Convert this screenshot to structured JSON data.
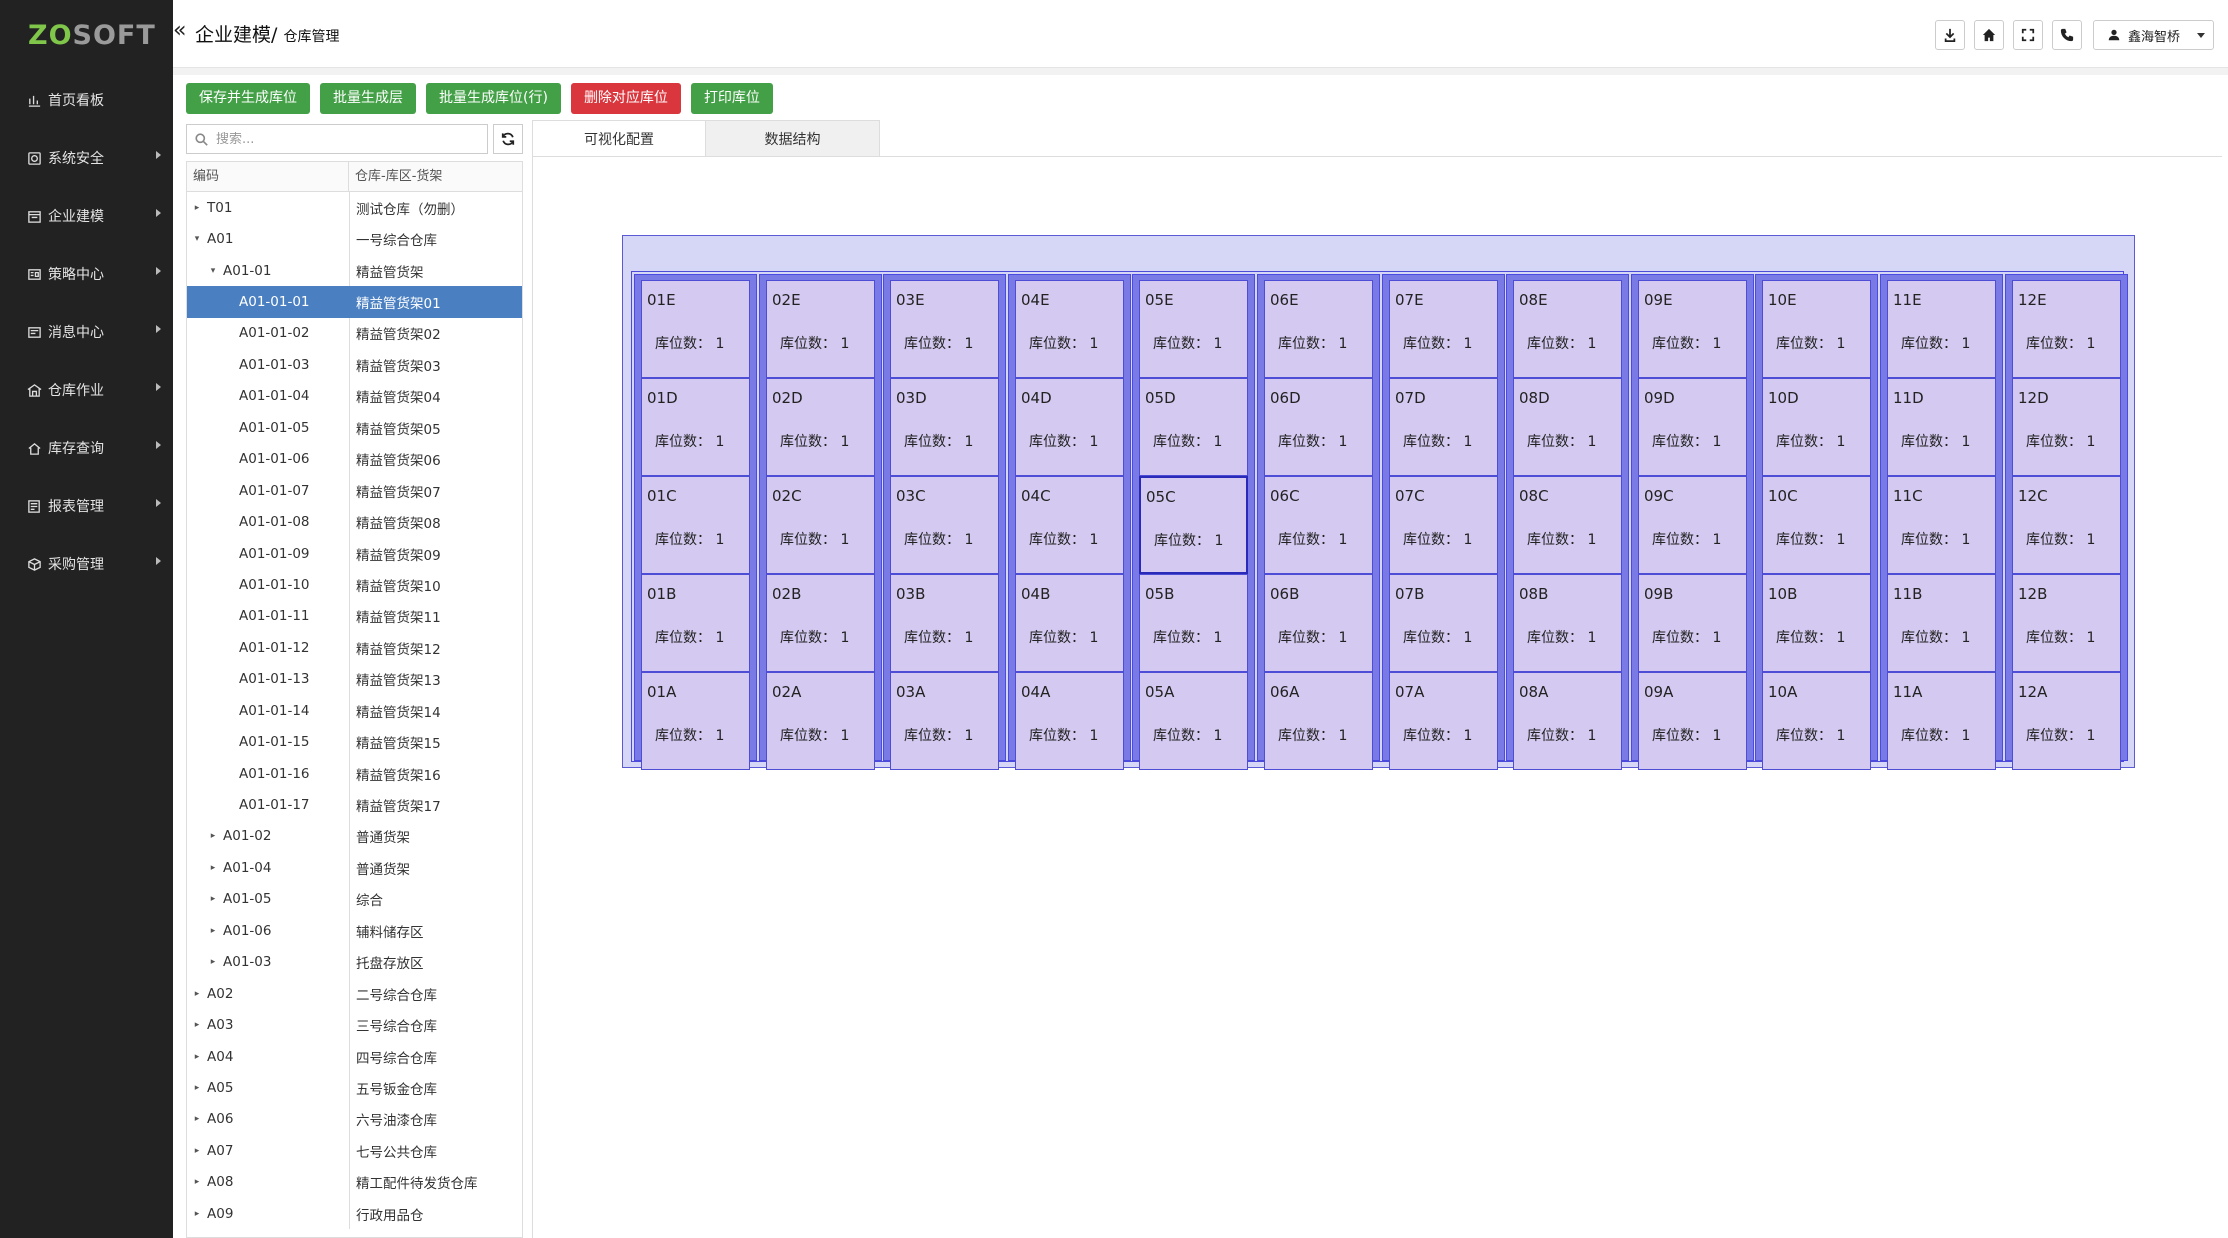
{
  "brand": {
    "logo_part1": "ZO",
    "logo_part2": "SOFT",
    "logo_color": "#7fc64a"
  },
  "sidebar": {
    "items": [
      {
        "label": "首页看板",
        "icon": "chart-icon",
        "has_children": false
      },
      {
        "label": "系统安全",
        "icon": "shield-icon",
        "has_children": true
      },
      {
        "label": "企业建模",
        "icon": "building-icon",
        "has_children": true
      },
      {
        "label": "策略中心",
        "icon": "strategy-icon",
        "has_children": true
      },
      {
        "label": "消息中心",
        "icon": "message-icon",
        "has_children": true
      },
      {
        "label": "仓库作业",
        "icon": "warehouse-icon",
        "has_children": true
      },
      {
        "label": "库存查询",
        "icon": "inventory-icon",
        "has_children": true
      },
      {
        "label": "报表管理",
        "icon": "report-icon",
        "has_children": true
      },
      {
        "label": "采购管理",
        "icon": "purchase-icon",
        "has_children": true
      }
    ]
  },
  "header": {
    "breadcrumb_main": "企业建模/",
    "breadcrumb_sub": "仓库管理",
    "tools": [
      "download-icon",
      "home-icon",
      "fullscreen-icon",
      "phone-icon"
    ],
    "user_name": "鑫海智桥"
  },
  "toolbar": {
    "buttons": [
      {
        "label": "保存并生成库位",
        "color": "#43a047"
      },
      {
        "label": "批量生成层",
        "color": "#43a047"
      },
      {
        "label": "批量生成库位(行)",
        "color": "#43a047"
      },
      {
        "label": "删除对应库位",
        "color": "#d9363e"
      },
      {
        "label": "打印库位",
        "color": "#43a047"
      }
    ]
  },
  "search": {
    "placeholder": "搜索...",
    "value": ""
  },
  "tree": {
    "columns": [
      "编码",
      "仓库-库区-货架"
    ],
    "rows": [
      {
        "code": "T01",
        "name": "测试仓库（勿删）",
        "level": 0,
        "toggle": "collapsed",
        "selected": false
      },
      {
        "code": "A01",
        "name": "一号综合仓库",
        "level": 0,
        "toggle": "expanded",
        "selected": false
      },
      {
        "code": "A01-01",
        "name": "精益管货架",
        "level": 1,
        "toggle": "expanded",
        "selected": false
      },
      {
        "code": "A01-01-01",
        "name": "精益管货架01",
        "level": 2,
        "toggle": "none",
        "selected": true
      },
      {
        "code": "A01-01-02",
        "name": "精益管货架02",
        "level": 2,
        "toggle": "none",
        "selected": false
      },
      {
        "code": "A01-01-03",
        "name": "精益管货架03",
        "level": 2,
        "toggle": "none",
        "selected": false
      },
      {
        "code": "A01-01-04",
        "name": "精益管货架04",
        "level": 2,
        "toggle": "none",
        "selected": false
      },
      {
        "code": "A01-01-05",
        "name": "精益管货架05",
        "level": 2,
        "toggle": "none",
        "selected": false
      },
      {
        "code": "A01-01-06",
        "name": "精益管货架06",
        "level": 2,
        "toggle": "none",
        "selected": false
      },
      {
        "code": "A01-01-07",
        "name": "精益管货架07",
        "level": 2,
        "toggle": "none",
        "selected": false
      },
      {
        "code": "A01-01-08",
        "name": "精益管货架08",
        "level": 2,
        "toggle": "none",
        "selected": false
      },
      {
        "code": "A01-01-09",
        "name": "精益管货架09",
        "level": 2,
        "toggle": "none",
        "selected": false
      },
      {
        "code": "A01-01-10",
        "name": "精益管货架10",
        "level": 2,
        "toggle": "none",
        "selected": false
      },
      {
        "code": "A01-01-11",
        "name": "精益管货架11",
        "level": 2,
        "toggle": "none",
        "selected": false
      },
      {
        "code": "A01-01-12",
        "name": "精益管货架12",
        "level": 2,
        "toggle": "none",
        "selected": false
      },
      {
        "code": "A01-01-13",
        "name": "精益管货架13",
        "level": 2,
        "toggle": "none",
        "selected": false
      },
      {
        "code": "A01-01-14",
        "name": "精益管货架14",
        "level": 2,
        "toggle": "none",
        "selected": false
      },
      {
        "code": "A01-01-15",
        "name": "精益管货架15",
        "level": 2,
        "toggle": "none",
        "selected": false
      },
      {
        "code": "A01-01-16",
        "name": "精益管货架16",
        "level": 2,
        "toggle": "none",
        "selected": false
      },
      {
        "code": "A01-01-17",
        "name": "精益管货架17",
        "level": 2,
        "toggle": "none",
        "selected": false
      },
      {
        "code": "A01-02",
        "name": "普通货架",
        "level": 1,
        "toggle": "collapsed",
        "selected": false
      },
      {
        "code": "A01-04",
        "name": "普通货架",
        "level": 1,
        "toggle": "collapsed",
        "selected": false
      },
      {
        "code": "A01-05",
        "name": "综合",
        "level": 1,
        "toggle": "collapsed",
        "selected": false
      },
      {
        "code": "A01-06",
        "name": "辅料储存区",
        "level": 1,
        "toggle": "collapsed",
        "selected": false
      },
      {
        "code": "A01-03",
        "name": "托盘存放区",
        "level": 1,
        "toggle": "collapsed",
        "selected": false
      },
      {
        "code": "A02",
        "name": "二号综合仓库",
        "level": 0,
        "toggle": "collapsed",
        "selected": false
      },
      {
        "code": "A03",
        "name": "三号综合仓库",
        "level": 0,
        "toggle": "collapsed",
        "selected": false
      },
      {
        "code": "A04",
        "name": "四号综合仓库",
        "level": 0,
        "toggle": "collapsed",
        "selected": false
      },
      {
        "code": "A05",
        "name": "五号钣金仓库",
        "level": 0,
        "toggle": "collapsed",
        "selected": false
      },
      {
        "code": "A06",
        "name": "六号油漆仓库",
        "level": 0,
        "toggle": "collapsed",
        "selected": false
      },
      {
        "code": "A07",
        "name": "七号公共仓库",
        "level": 0,
        "toggle": "collapsed",
        "selected": false
      },
      {
        "code": "A08",
        "name": "精工配件待发货仓库",
        "level": 0,
        "toggle": "collapsed",
        "selected": false
      },
      {
        "code": "A09",
        "name": "行政用品仓",
        "level": 0,
        "toggle": "collapsed",
        "selected": false
      }
    ]
  },
  "tabs": [
    {
      "label": "可视化配置",
      "active": true
    },
    {
      "label": "数据结构",
      "active": false
    }
  ],
  "rack": {
    "columns": [
      "01",
      "02",
      "03",
      "04",
      "05",
      "06",
      "07",
      "08",
      "09",
      "10",
      "11",
      "12"
    ],
    "levels": [
      "E",
      "D",
      "C",
      "B",
      "A"
    ],
    "count_label": "库位数：",
    "count_value": "1",
    "highlighted_cell": "05C",
    "colors": {
      "outer": "#d6d6f7",
      "column": "#7a7ae6",
      "cell": "#d4c9f0",
      "border": "#4b4bd8"
    }
  }
}
